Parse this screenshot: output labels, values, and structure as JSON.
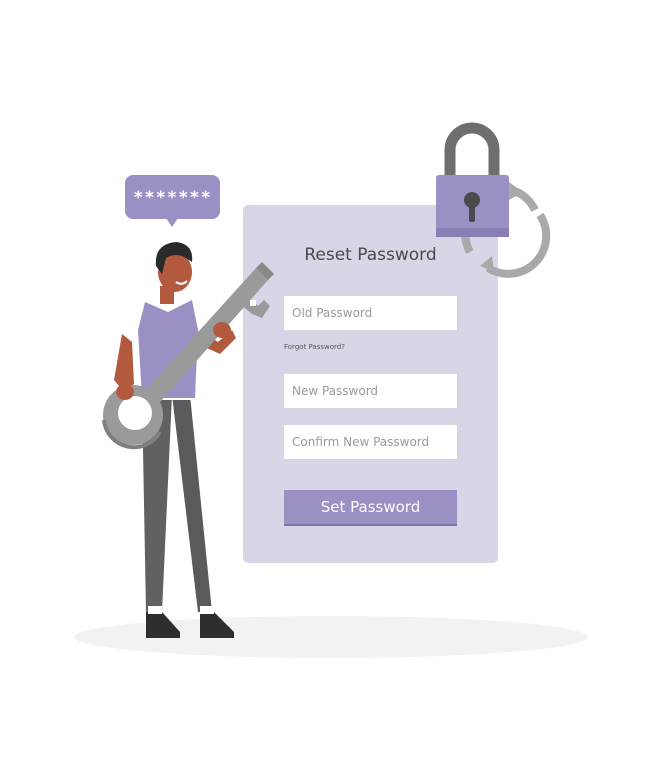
{
  "reset_form": {
    "title": "Reset Password",
    "old_password": {
      "placeholder": "Old Password",
      "value": ""
    },
    "forgot_link": "Forgot Password?",
    "new_password": {
      "placeholder": "New Password",
      "value": ""
    },
    "confirm_password": {
      "placeholder": "Confirm New Password",
      "value": ""
    },
    "submit_label": "Set Password"
  },
  "speech_bubble": {
    "text": "*******"
  },
  "icons": {
    "lock": "padlock-icon",
    "refresh": "refresh-arrows-icon",
    "key": "key-icon"
  },
  "colors": {
    "accent": "#9b8fc4",
    "card_background": "#d8d5e6",
    "skin": "#b35a3e",
    "trousers": "#585a5c",
    "key": "#9a9a9a"
  }
}
